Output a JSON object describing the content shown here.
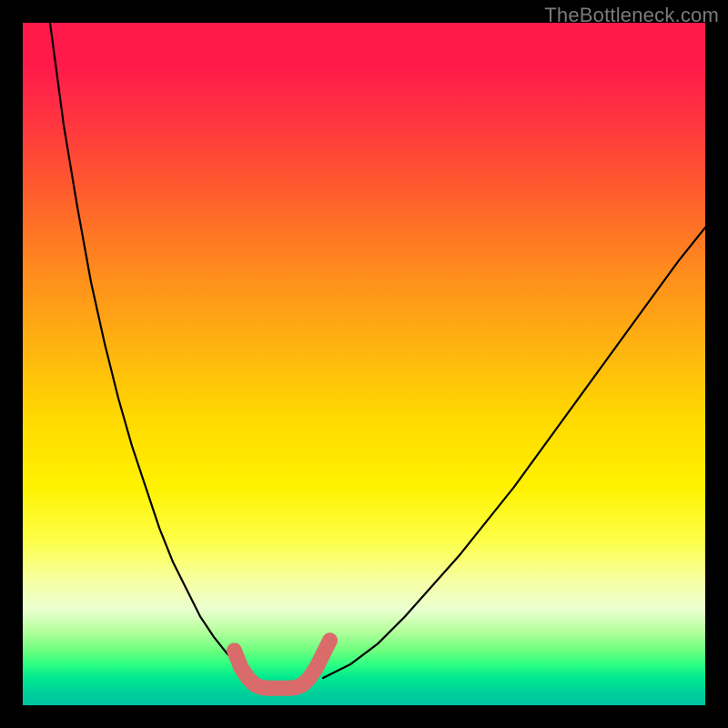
{
  "watermark": "TheBottleneck.com",
  "chart_data": {
    "type": "line",
    "title": "",
    "xlabel": "",
    "ylabel": "",
    "xlim": [
      0,
      100
    ],
    "ylim": [
      0,
      100
    ],
    "series": [
      {
        "name": "black-left-curve",
        "x": [
          4,
          6,
          8,
          10,
          12,
          14,
          16,
          18,
          20,
          22,
          24,
          26,
          28,
          30,
          32,
          34
        ],
        "y": [
          100,
          85,
          73,
          62,
          53,
          45,
          38,
          32,
          26,
          21,
          17,
          13,
          10,
          7.5,
          5.5,
          4
        ]
      },
      {
        "name": "black-right-curve",
        "x": [
          44,
          48,
          52,
          56,
          60,
          64,
          68,
          72,
          76,
          80,
          84,
          88,
          92,
          96,
          100
        ],
        "y": [
          4,
          6,
          9,
          13,
          17.5,
          22,
          27,
          32,
          37.5,
          43,
          48.5,
          54,
          59.5,
          65,
          70
        ]
      },
      {
        "name": "salmon-trough-curve",
        "x": [
          31,
          32,
          33,
          34,
          35,
          36,
          37,
          38,
          39,
          40,
          41,
          42,
          43,
          44,
          45
        ],
        "y": [
          8,
          5.5,
          4,
          3,
          2.6,
          2.5,
          2.5,
          2.5,
          2.5,
          2.6,
          3,
          4,
          5.5,
          7.5,
          9.5
        ]
      }
    ],
    "gradient_colors": {
      "top": "#ff1a4b",
      "mid_upper": "#ffb50f",
      "mid": "#fff200",
      "mid_lower": "#b8ff9e",
      "bottom": "#00c3a0"
    },
    "trough_line_color": "#d96b6b",
    "curve_line_color": "#000000"
  }
}
